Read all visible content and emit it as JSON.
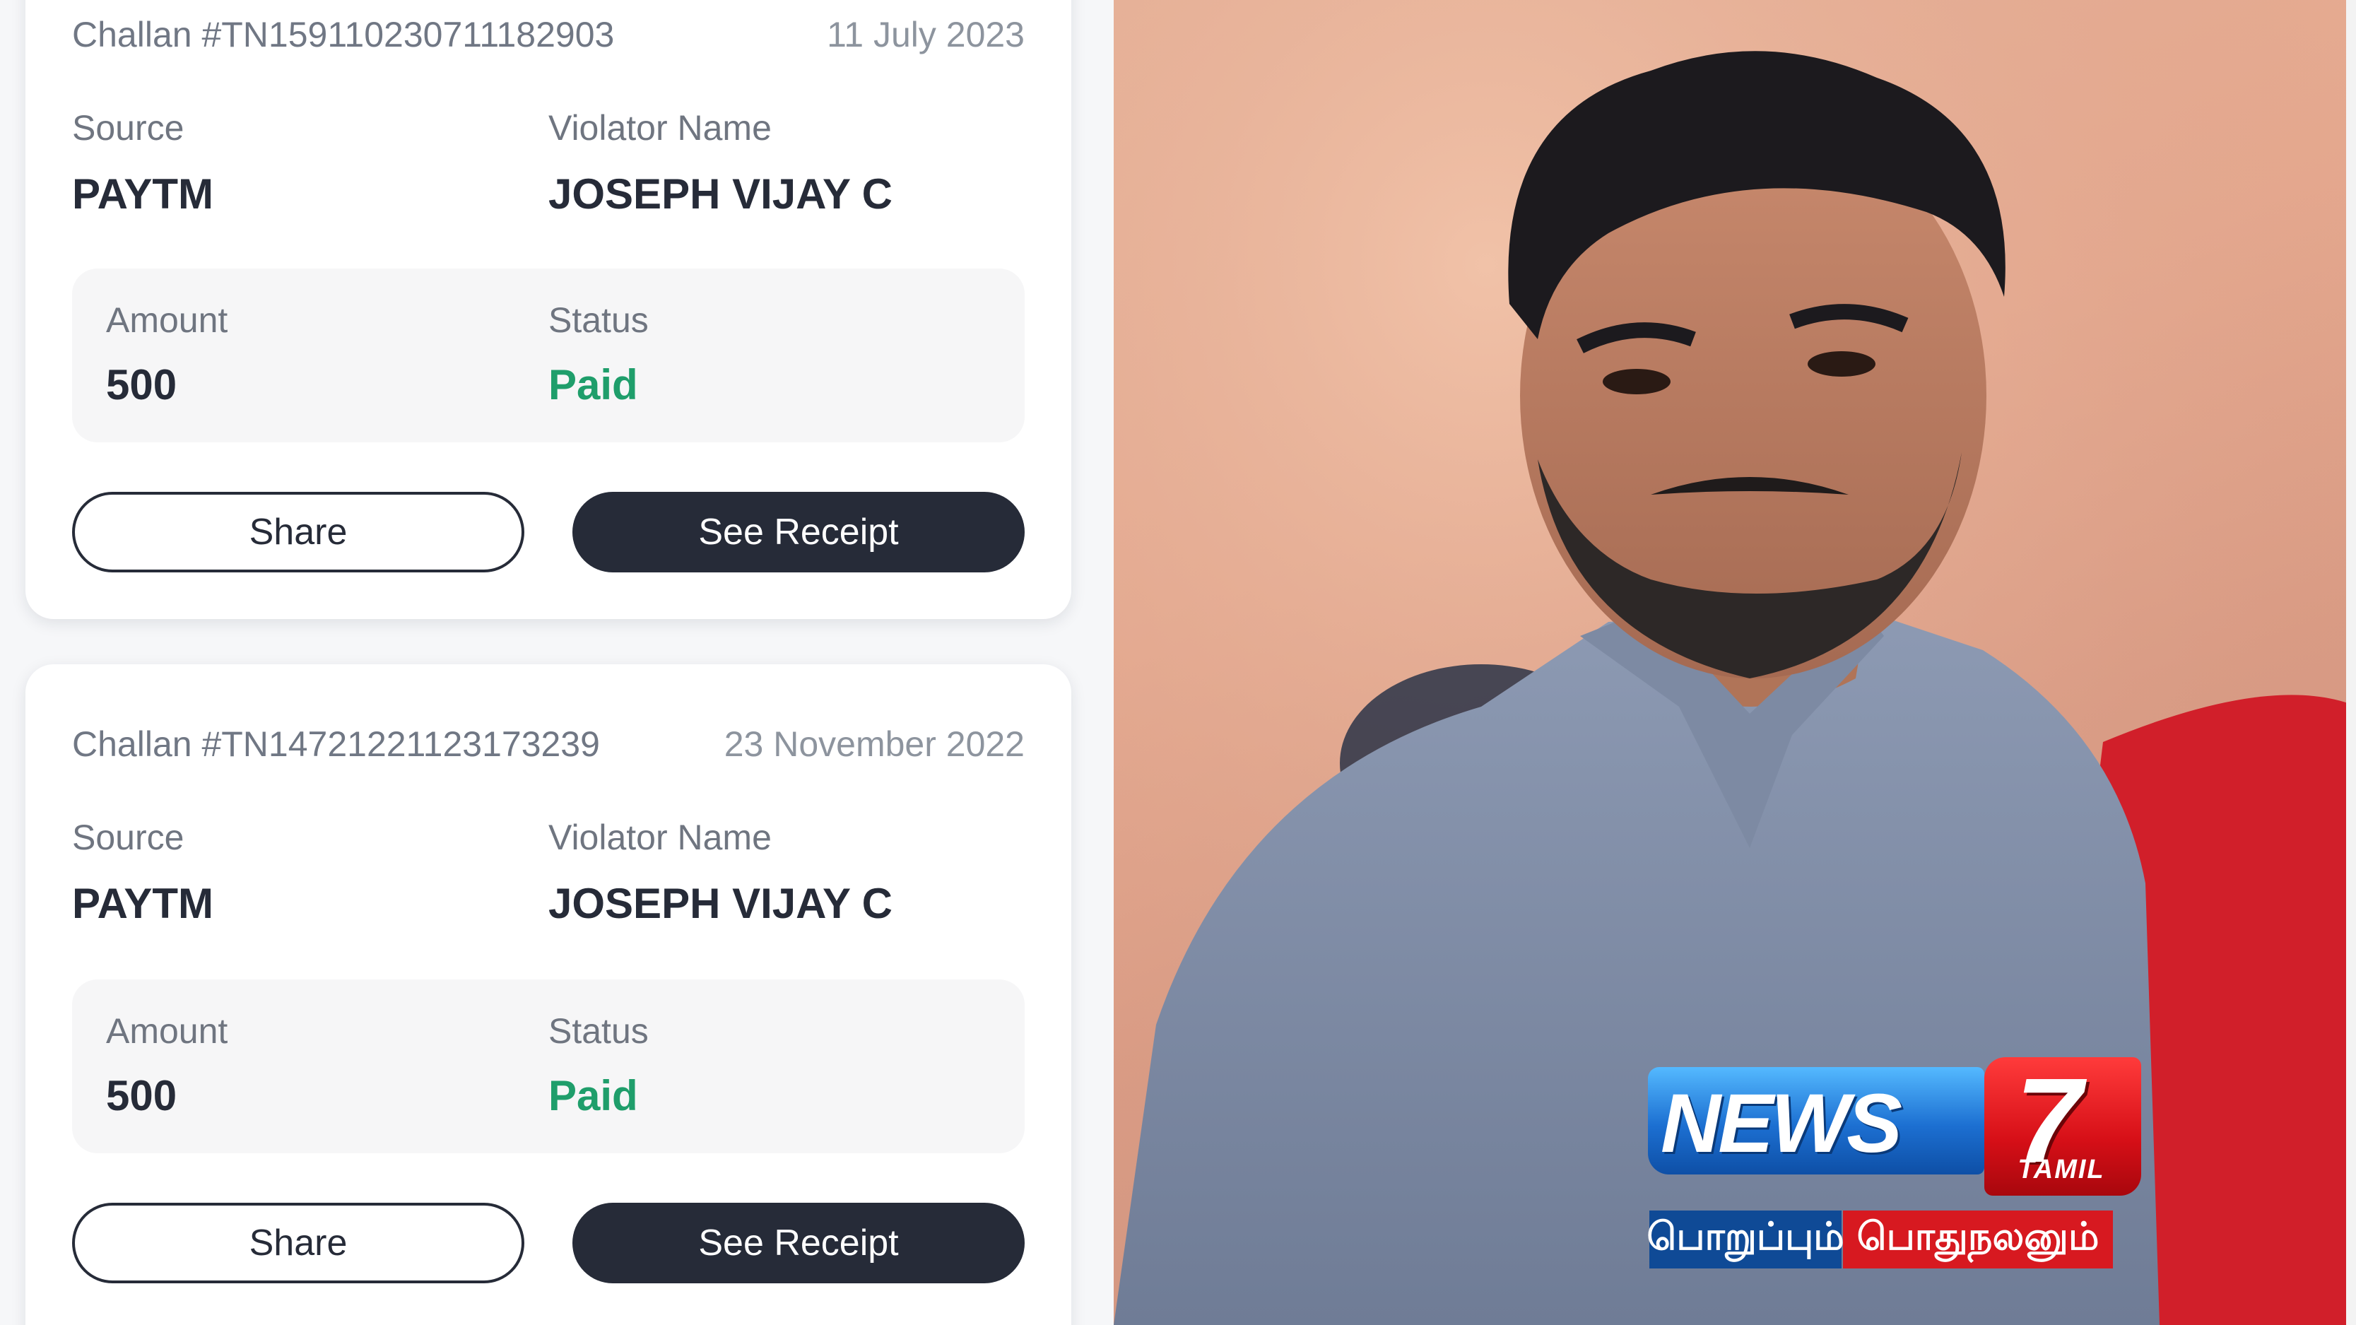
{
  "challans": [
    {
      "challan_id": "Challan #TN15911023071118​2903",
      "date": "11 July 2023",
      "source_label": "Source",
      "source_value": "PAYTM",
      "violator_label": "Violator Name",
      "violator_value": "JOSEPH VIJAY C",
      "amount_label": "Amount",
      "amount_value": "500",
      "status_label": "Status",
      "status_value": "Paid",
      "share_label": "Share",
      "receipt_label": "See Receipt"
    },
    {
      "challan_id": "Challan #TN14721221123173239",
      "date": "23 November 2022",
      "source_label": "Source",
      "source_value": "PAYTM",
      "violator_label": "Violator Name",
      "violator_value": "JOSEPH VIJAY C",
      "amount_label": "Amount",
      "amount_value": "500",
      "status_label": "Status",
      "status_value": "Paid",
      "share_label": "Share",
      "receipt_label": "See Receipt"
    }
  ],
  "logo": {
    "news": "NEWS",
    "seven": "7",
    "tamil": "TAMIL",
    "tagline_left": "பொறுப்பும்",
    "tagline_right": "பொதுநலனும்"
  },
  "colors": {
    "button_dark": "#262b38",
    "status_paid": "#1f9e6b",
    "logo_blue": "#1c6fd1",
    "logo_red": "#d60f17"
  }
}
